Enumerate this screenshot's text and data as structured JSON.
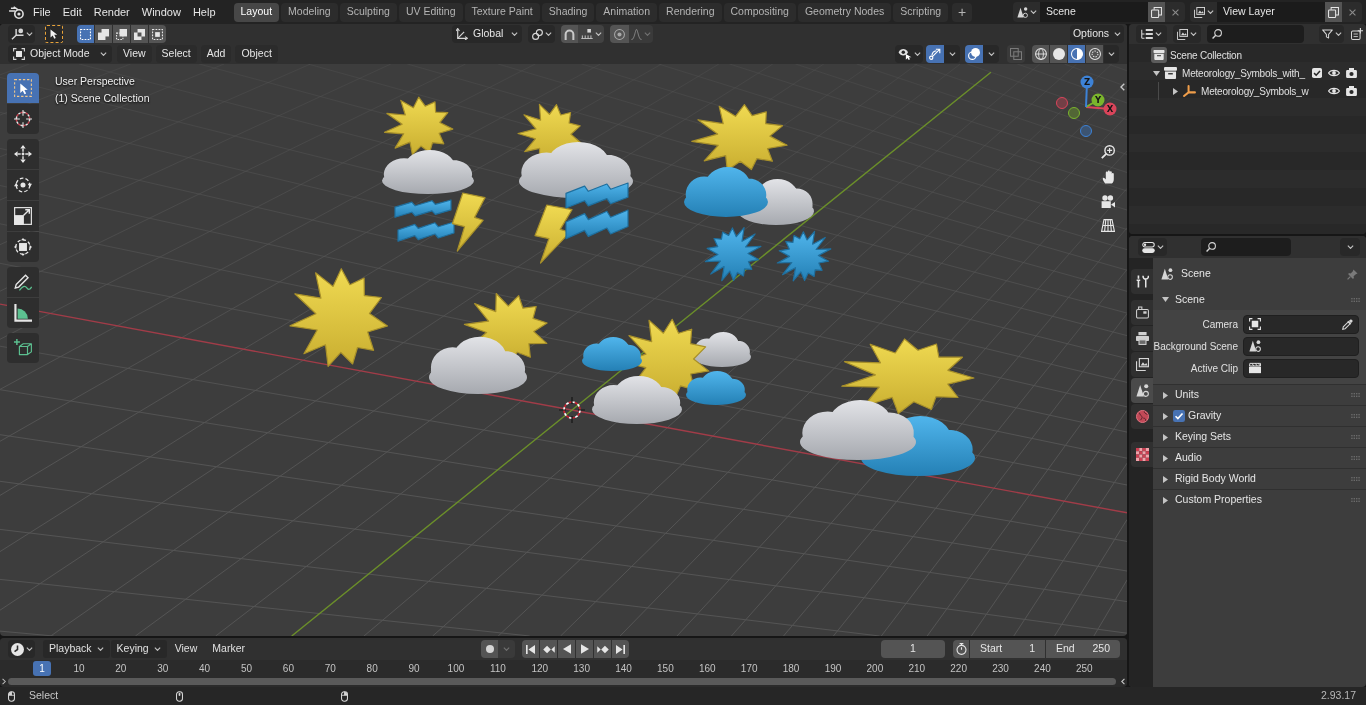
{
  "top_bar": {
    "menus": [
      "File",
      "Edit",
      "Render",
      "Window",
      "Help"
    ],
    "workspaces": [
      {
        "label": "Layout",
        "selected": true
      },
      {
        "label": "Modeling",
        "selected": false
      },
      {
        "label": "Sculpting",
        "selected": false
      },
      {
        "label": "UV Editing",
        "selected": false
      },
      {
        "label": "Texture Paint",
        "selected": false
      },
      {
        "label": "Shading",
        "selected": false
      },
      {
        "label": "Animation",
        "selected": false
      },
      {
        "label": "Rendering",
        "selected": false
      },
      {
        "label": "Compositing",
        "selected": false
      },
      {
        "label": "Geometry Nodes",
        "selected": false
      },
      {
        "label": "Scripting",
        "selected": false
      }
    ],
    "add_workspace": "+",
    "scene": "Scene",
    "view_layer": "View Layer"
  },
  "tool_header": {
    "select_modes": [
      {
        "kind": "set",
        "selected": true
      },
      {
        "kind": "extend",
        "selected": false
      },
      {
        "kind": "subtract",
        "selected": false
      },
      {
        "kind": "invert",
        "selected": false
      },
      {
        "kind": "intersect",
        "selected": false
      }
    ],
    "orientation": "Global",
    "toggles": [
      {
        "kind": "snap",
        "on": false
      },
      {
        "kind": "proportional",
        "on": false
      }
    ],
    "options": "Options"
  },
  "viewport_header": {
    "mode": "Object Mode",
    "menus": [
      "View",
      "Select",
      "Add",
      "Object"
    ],
    "toggles": [
      {
        "kind": "gizmos",
        "on": true
      },
      {
        "kind": "overlays",
        "on": true
      },
      {
        "kind": "xray",
        "on": false
      }
    ],
    "shading_modes": [
      {
        "kind": "wireframe",
        "selected": false
      },
      {
        "kind": "solid",
        "selected": false
      },
      {
        "kind": "material",
        "selected": true
      },
      {
        "kind": "rendered",
        "selected": false
      }
    ]
  },
  "viewport": {
    "info": [
      "User Perspective",
      "(1) Scene Collection"
    ],
    "tool_groups": [
      {
        "tools": [
          {
            "kind": "select_box",
            "selected": true
          },
          {
            "kind": "cursor",
            "selected": false
          }
        ]
      },
      {
        "tools": [
          {
            "kind": "move",
            "selected": false
          },
          {
            "kind": "rotate",
            "selected": false
          },
          {
            "kind": "scale",
            "selected": false
          },
          {
            "kind": "transform",
            "selected": false
          }
        ]
      },
      {
        "tools": [
          {
            "kind": "annotate",
            "selected": false
          },
          {
            "kind": "measure",
            "selected": false
          }
        ]
      },
      {
        "tools": [
          {
            "kind": "add_cube",
            "selected": false
          }
        ]
      }
    ],
    "gizmo_axes": [
      {
        "label": "X",
        "color": "#d9445a"
      },
      {
        "label": "Y",
        "color": "#7ab52c"
      },
      {
        "label": "Z",
        "color": "#3d82d6"
      }
    ]
  },
  "outliner": {
    "root": "Scene Collection",
    "items": [
      {
        "kind": "collection",
        "label": "Meteorology_Symbols_with_",
        "expanded": true,
        "checked": true,
        "children": [
          {
            "kind": "empty",
            "label": "Meteorology_Symbols_w",
            "expanded": false
          }
        ]
      }
    ]
  },
  "properties": {
    "tab_groups": [
      {
        "tabs": [
          {
            "kind": "tool",
            "selected": false
          }
        ]
      },
      {
        "tabs": [
          {
            "kind": "render",
            "selected": false
          },
          {
            "kind": "output",
            "selected": false
          },
          {
            "kind": "view_layer",
            "selected": false
          },
          {
            "kind": "scene",
            "selected": true
          },
          {
            "kind": "world",
            "selected": false
          }
        ]
      },
      {
        "tabs": [
          {
            "kind": "texture",
            "selected": false
          }
        ]
      }
    ],
    "context": "Scene",
    "panels": [
      {
        "label": "Scene",
        "expanded": true,
        "fields": [
          {
            "kind": "camera",
            "label": "Camera"
          },
          {
            "kind": "scene",
            "label": "Background Scene"
          },
          {
            "kind": "clip",
            "label": "Active Clip"
          }
        ]
      },
      {
        "label": "Units",
        "expanded": false
      },
      {
        "label": "Gravity",
        "expanded": false,
        "checked": true
      },
      {
        "label": "Keying Sets",
        "expanded": false
      },
      {
        "label": "Audio",
        "expanded": false
      },
      {
        "label": "Rigid Body World",
        "expanded": false
      },
      {
        "label": "Custom Properties",
        "expanded": false
      }
    ]
  },
  "timeline": {
    "menus": [
      {
        "kind": "dropdown",
        "label": "Playback"
      },
      {
        "kind": "dropdown",
        "label": "Keying"
      },
      {
        "kind": "menu",
        "label": "View"
      },
      {
        "kind": "menu",
        "label": "Marker"
      }
    ],
    "auto_keying": false,
    "current_frame": "1",
    "start": {
      "label": "Start",
      "value": "1"
    },
    "end": {
      "label": "End",
      "value": "250"
    },
    "playhead": "1",
    "ruler": [
      "10",
      "20",
      "30",
      "40",
      "50",
      "60",
      "70",
      "80",
      "90",
      "100",
      "110",
      "120",
      "130",
      "140",
      "150",
      "160",
      "170",
      "180",
      "190",
      "200",
      "210",
      "220",
      "230",
      "240",
      "250"
    ]
  },
  "status_bar": {
    "hint": "Select",
    "version": "2.93.17"
  }
}
